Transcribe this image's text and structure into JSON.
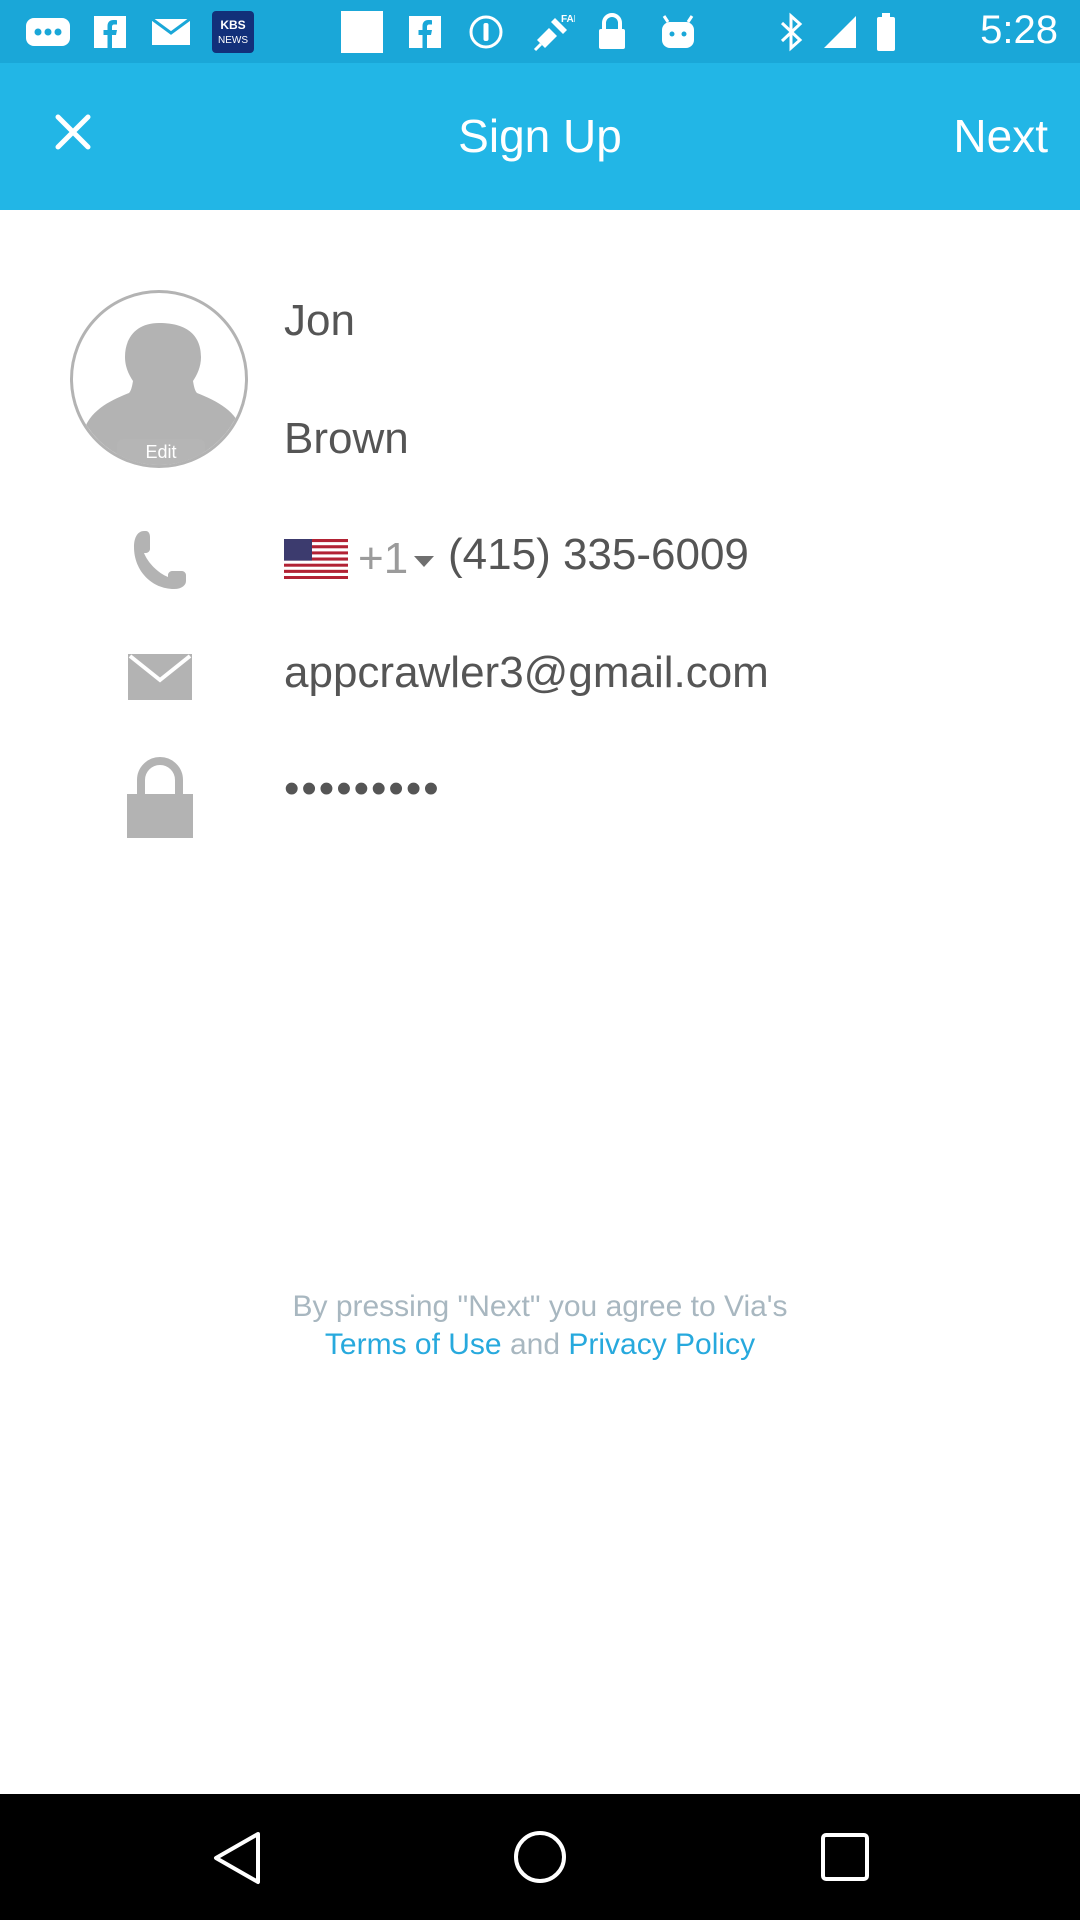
{
  "status_bar": {
    "time": "5:28",
    "left_icons": [
      "more-icon",
      "facebook-icon",
      "mail-icon",
      "kbs-news-icon",
      "blank-notification-icon",
      "facebook-icon",
      "info-icon",
      "fake-gps-icon",
      "lock-icon",
      "android-icon"
    ],
    "kbs_label": "KBS NEWS",
    "right_icons": [
      "bluetooth-icon",
      "signal-icon",
      "battery-icon"
    ],
    "color": "#1aa7d8"
  },
  "app_bar": {
    "title": "Sign Up",
    "next_label": "Next",
    "color": "#22b6e6"
  },
  "profile": {
    "avatar_edit_label": "Edit",
    "first_name": "Jon",
    "last_name": "Brown"
  },
  "phone": {
    "country_flag": "us-flag",
    "dial_code": "+1",
    "number": "(415) 335-6009"
  },
  "email": {
    "value": "appcrawler3@gmail.com"
  },
  "password": {
    "value": "•••••••••"
  },
  "terms": {
    "prefix": "By pressing \"Next\" you agree to Via's",
    "terms_link": "Terms of Use",
    "connector": " and ",
    "privacy_link": "Privacy Policy",
    "link_color": "#27a9dd"
  },
  "nav_bar": {
    "buttons": [
      "back-icon",
      "home-icon",
      "recents-icon"
    ]
  }
}
